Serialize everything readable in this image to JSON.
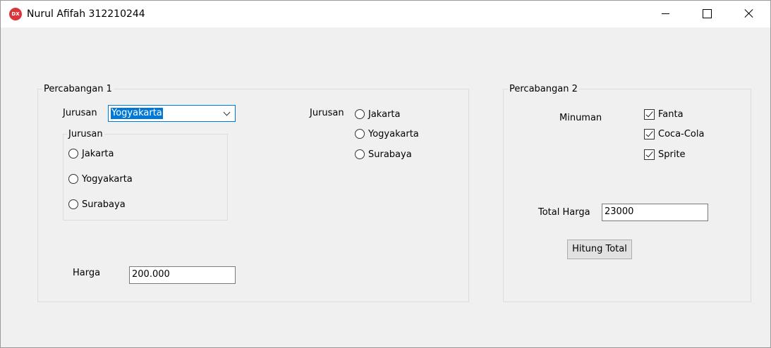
{
  "window": {
    "title": "Nurul Afifah 312210244",
    "icon": "DX"
  },
  "group1": {
    "caption": "Percabangan 1",
    "jurusan_label": "Jurusan",
    "combo_value": "Yogyakarta",
    "inner_group_caption": "Jurusan",
    "inner_radios": [
      "Jakarta",
      "Yogyakarta",
      "Surabaya"
    ],
    "jurusan_label2": "Jurusan",
    "radios2": [
      "Jakarta",
      "Yogyakarta",
      "Surabaya"
    ],
    "harga_label": "Harga",
    "harga_value": "200.000"
  },
  "group2": {
    "caption": "Percabangan 2",
    "minuman_label": "Minuman",
    "checks": [
      "Fanta",
      "Coca-Cola",
      "Sprite"
    ],
    "total_label": "Total Harga",
    "total_value": "23000",
    "hitung_button": "Hitung Total"
  }
}
